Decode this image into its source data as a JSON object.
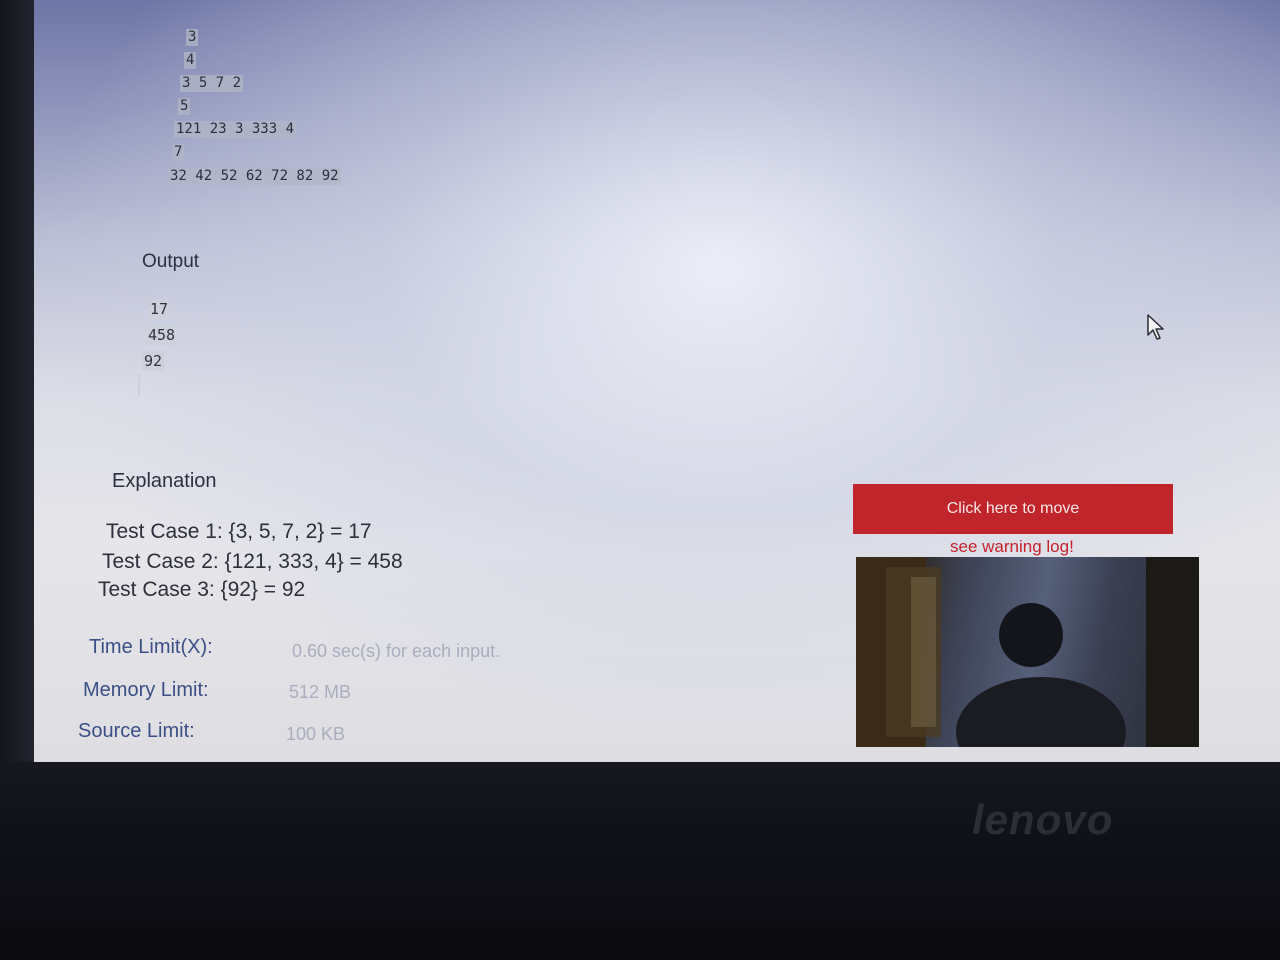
{
  "input": {
    "lines": [
      "3",
      "4",
      "3 5 7 2",
      "5",
      "121 23 3 333 4",
      "7",
      "32 42 52 62 72 82 92"
    ]
  },
  "output": {
    "title": "Output",
    "lines": [
      "17",
      "458",
      "92"
    ]
  },
  "explanation": {
    "title": "Explanation",
    "lines": [
      "Test Case 1: {3, 5, 7, 2} = 17",
      "Test Case 2: {121, 333, 4} = 458",
      "Test Case 3: {92} = 92"
    ]
  },
  "limits": {
    "time_label": "Time Limit(X):",
    "time_value": "0.60 sec(s) for each input.",
    "memory_label": "Memory Limit:",
    "memory_value": "512 MB",
    "source_label": "Source Limit:",
    "source_value": "100 KB"
  },
  "proctor": {
    "move_button": "Click here to move",
    "warning_link": "see warning log!"
  },
  "brand": {
    "logo": "lenovo"
  },
  "colors": {
    "accent_red": "#c0252b",
    "link_red": "#c5222c",
    "label_blue": "#3b4f86"
  }
}
